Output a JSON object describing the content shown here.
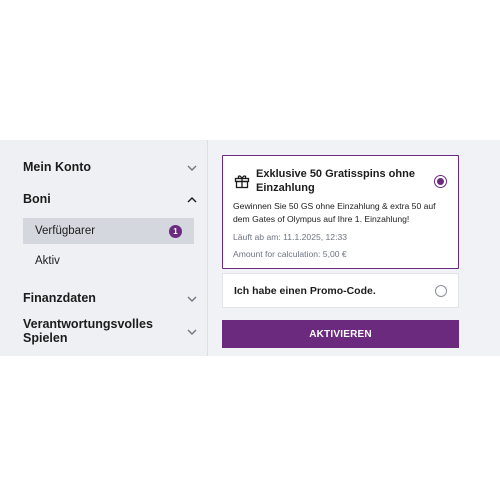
{
  "sidebar": {
    "items": [
      {
        "label": "Mein Konto",
        "chevron": "chevron-down-icon"
      },
      {
        "label": "Boni",
        "chevron": "chevron-up-icon"
      },
      {
        "label": "Finanzdaten",
        "chevron": "chevron-down-icon"
      },
      {
        "label": "Verantwortungsvolles Spielen",
        "chevron": "chevron-down-icon"
      }
    ],
    "boni_sub": [
      {
        "label": "Verfügbarer",
        "badge": "1",
        "active": true
      },
      {
        "label": "Aktiv"
      }
    ]
  },
  "offer": {
    "icon": "gift-icon",
    "title": "Exklusive 50 Gratisspins ohne Einzahlung",
    "description": "Gewinnen Sie 50 GS ohne Einzahlung & extra 50 auf dem Gates of Olympus auf Ihre 1. Einzahlung!",
    "expires": "Läuft ab am: 11.1.2025, 12:33",
    "amount": "Amount for calculation: 5,00 €",
    "selected": true
  },
  "promo": {
    "label": "Ich habe einen Promo-Code."
  },
  "activate_label": "AKTIVIEREN",
  "colors": {
    "accent": "#6b2a7e",
    "sidebar_bg": "#eef0f3",
    "active_item_bg": "#d4d8de"
  }
}
